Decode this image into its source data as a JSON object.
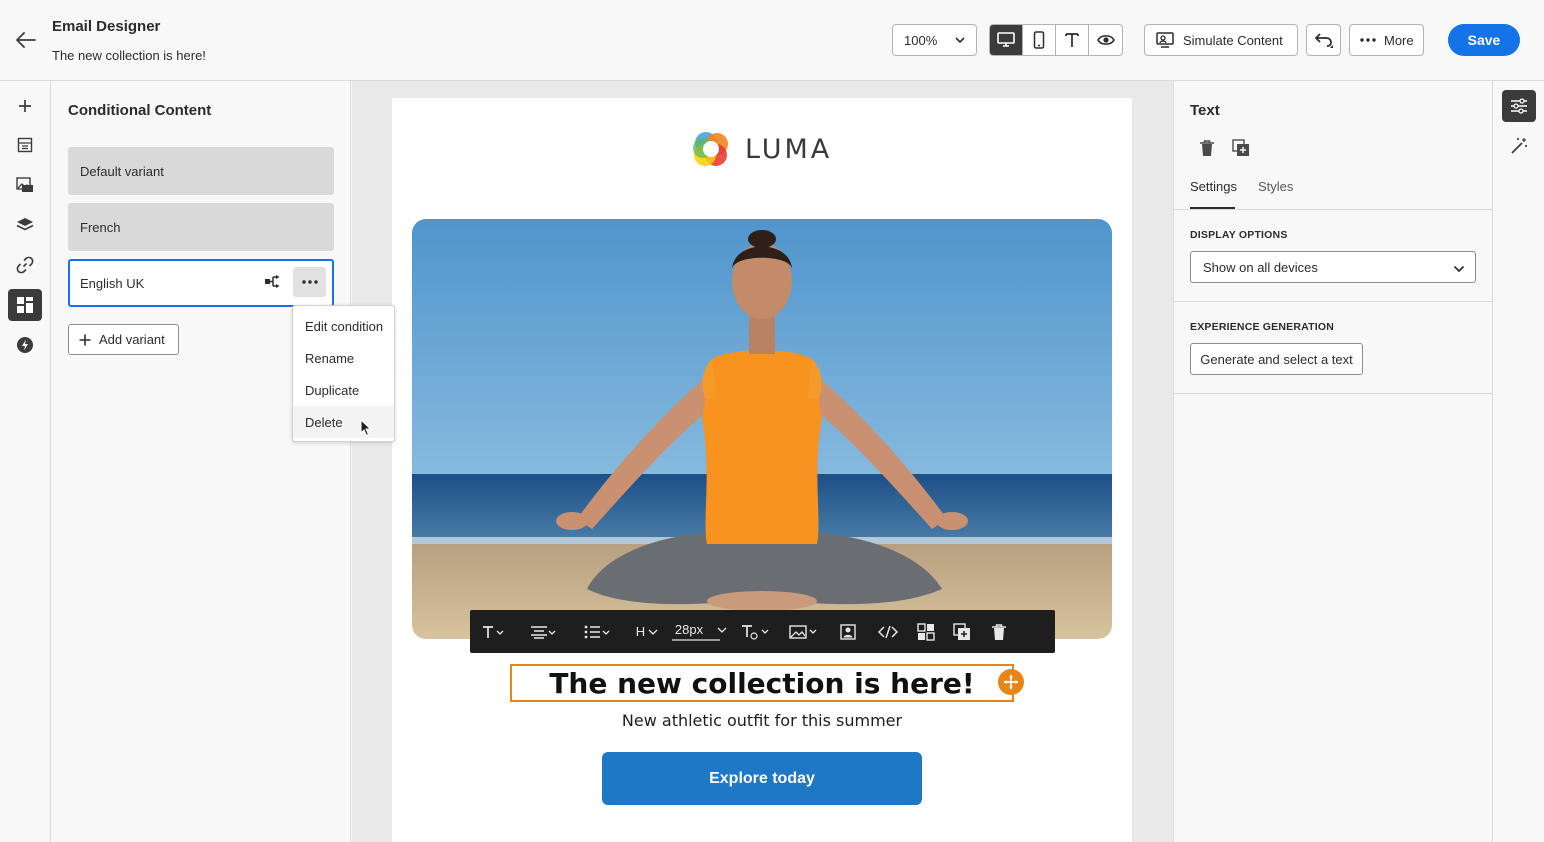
{
  "header": {
    "title": "Email Designer",
    "subtitle": "The new collection is here!",
    "zoom": "100%",
    "simulate_label": "Simulate Content",
    "more_label": "More",
    "save_label": "Save"
  },
  "left_panel": {
    "title": "Conditional Content",
    "variants": [
      {
        "label": "Default variant",
        "selected": false
      },
      {
        "label": "French",
        "selected": false
      },
      {
        "label": "English UK",
        "selected": true
      }
    ],
    "add_variant_label": "Add variant",
    "context_menu": [
      "Edit condition",
      "Rename",
      "Duplicate",
      "Delete"
    ]
  },
  "email": {
    "logo_text": "LUMA",
    "headline": "The new collection is here!",
    "subline": "New athletic outfit for this summer",
    "cta_label": "Explore today",
    "toolbar": {
      "heading_label": "H",
      "font_size": "28px"
    }
  },
  "right_panel": {
    "title": "Text",
    "tabs": [
      "Settings",
      "Styles"
    ],
    "active_tab": "Settings",
    "display_options_label": "DISPLAY OPTIONS",
    "display_options_value": "Show on all devices",
    "experience_label": "EXPERIENCE GENERATION",
    "generate_label": "Generate and select a text"
  },
  "colors": {
    "accent": "#1473e6",
    "selection": "#e68619",
    "cta": "#1f78c6"
  },
  "icons": {
    "left_rail": [
      "plus-icon",
      "fragments-icon",
      "assets-icon",
      "layers-icon",
      "link-icon",
      "conditional-content-icon",
      "personalization-icon"
    ],
    "right_rail": [
      "settings-icon",
      "magic-wand-icon"
    ]
  }
}
